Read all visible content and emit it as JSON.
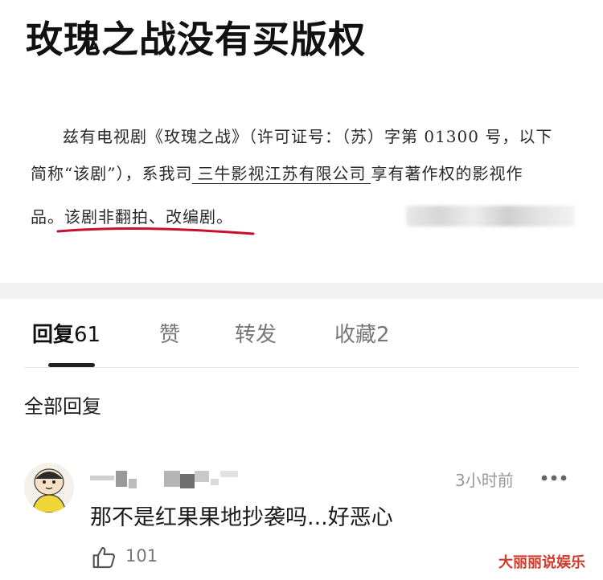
{
  "post": {
    "title": "玫瑰之战没有买版权",
    "document": {
      "line1": "兹有电视剧《玫瑰之战》（许可证号：（苏）字第 01300 号，以下",
      "line2_pre": "简称“该剧”），系我司",
      "company": "三牛影视江苏有限公司",
      "line2_post": "享有著作权的影视作",
      "line3_pre": "品。",
      "line3_highlight": "该剧非翻拍、改编剧。"
    }
  },
  "tabs": [
    {
      "label": "回复",
      "count": "61"
    },
    {
      "label": "赞",
      "count": ""
    },
    {
      "label": "转发",
      "count": ""
    },
    {
      "label": "收藏",
      "count": "2"
    }
  ],
  "section_header": "全部回复",
  "comment": {
    "time": "3小时前",
    "text": "那不是红果果地抄袭吗...好恶心",
    "like_count": "101"
  },
  "watermark": "大丽丽说娱乐",
  "colors": {
    "highlight_underline": "#c8102e",
    "watermark": "#d23a2a"
  },
  "icons": [
    "more-icon",
    "like-icon",
    "avatar"
  ]
}
